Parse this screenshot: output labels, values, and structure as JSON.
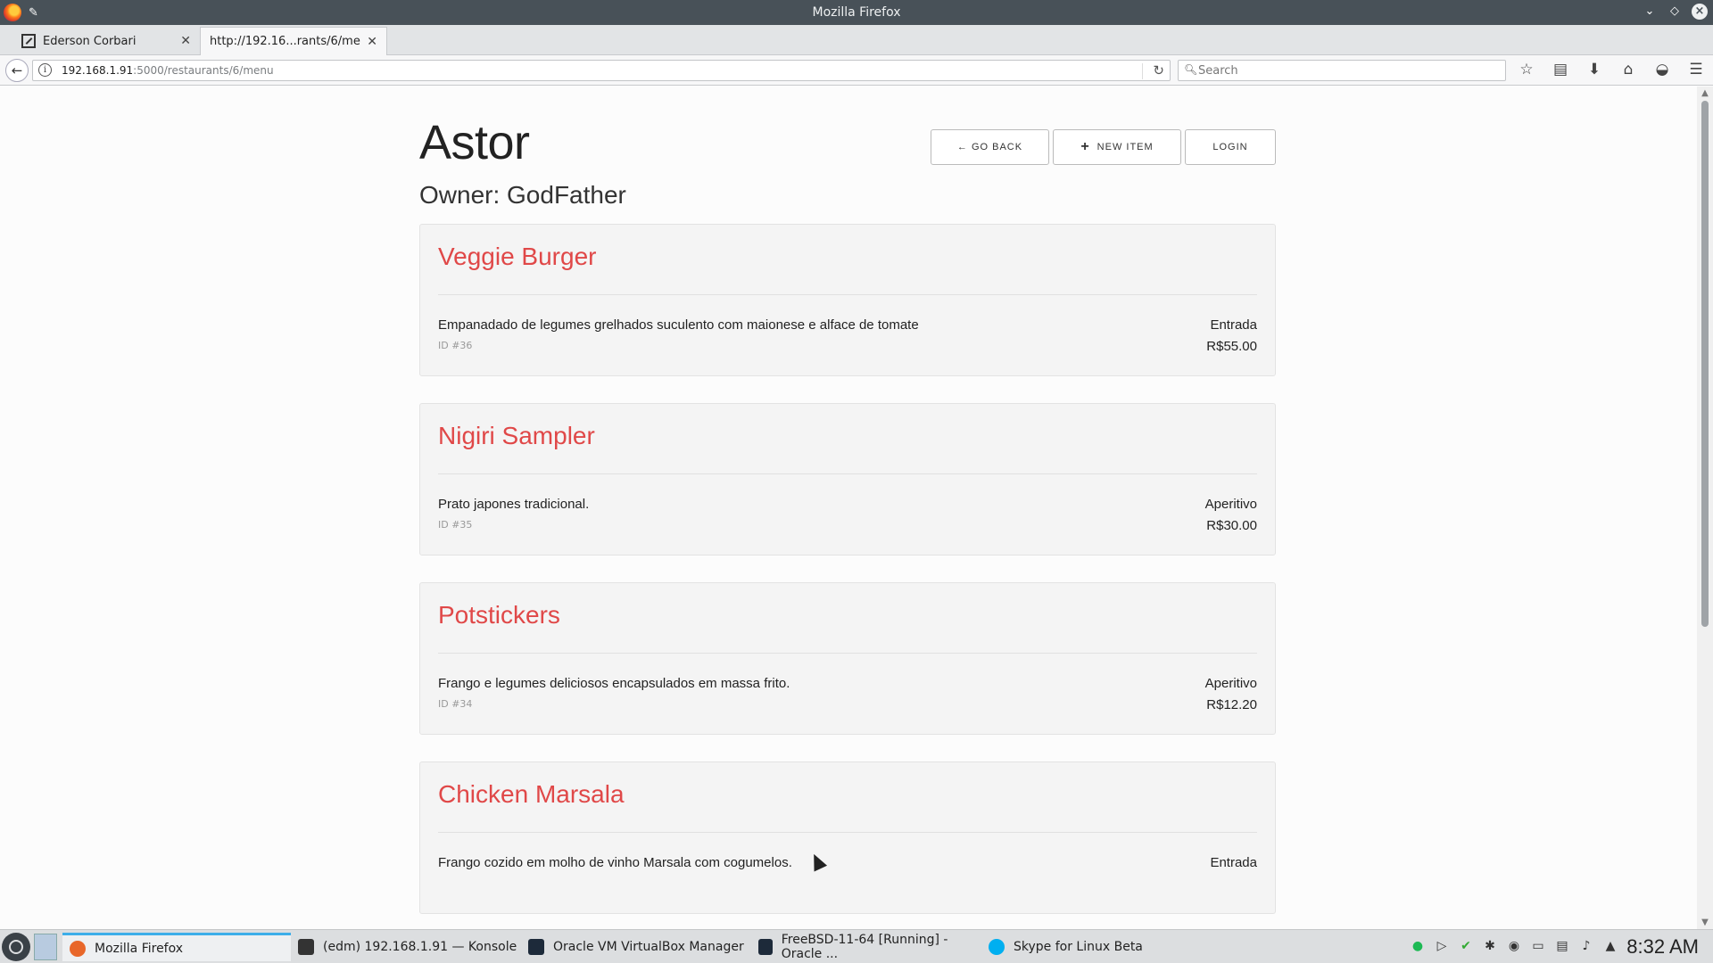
{
  "window": {
    "title": "Mozilla Firefox"
  },
  "tabs": [
    {
      "label": "Ederson Corbari"
    },
    {
      "label": "http://192.16...rants/6/menu"
    }
  ],
  "nav": {
    "url_host": "192.168.1.91",
    "url_path": ":5000/restaurants/6/menu",
    "search_placeholder": "Search"
  },
  "page": {
    "restaurant_name": "Astor",
    "owner": "Owner: GodFather",
    "buttons": {
      "back": "← GO BACK",
      "new_item": "NEW ITEM",
      "login": "LOGIN"
    },
    "items": [
      {
        "name": "Veggie Burger",
        "description": "Empanadado de legumes grelhados suculento com maionese e alface de tomate",
        "id": "ID #36",
        "course": "Entrada",
        "price": "R$55.00"
      },
      {
        "name": "Nigiri Sampler",
        "description": "Prato japones tradicional.",
        "id": "ID #35",
        "course": "Aperitivo",
        "price": "R$30.00"
      },
      {
        "name": "Potstickers",
        "description": "Frango e legumes deliciosos encapsulados em massa frito.",
        "id": "ID #34",
        "course": "Aperitivo",
        "price": "R$12.20"
      },
      {
        "name": "Chicken Marsala",
        "description": "Frango cozido em molho de vinho Marsala com cogumelos.",
        "id": "",
        "course": "Entrada",
        "price": ""
      }
    ]
  },
  "taskbar": {
    "tasks": [
      {
        "label": "Mozilla Firefox"
      },
      {
        "label": "(edm) 192.168.1.91 — Konsole"
      },
      {
        "label": "Oracle VM VirtualBox Manager"
      },
      {
        "label": "FreeBSD-11-64 [Running] - Oracle ..."
      },
      {
        "label": "Skype for Linux Beta"
      }
    ],
    "clock": "8:32 AM"
  },
  "colors": {
    "item_title": "#e04848",
    "accent": "#3daee9"
  }
}
